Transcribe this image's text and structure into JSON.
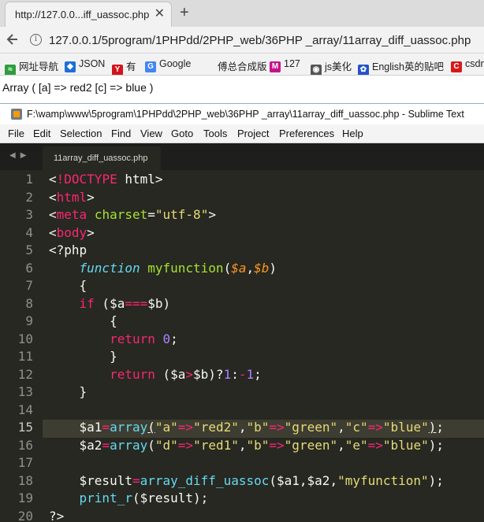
{
  "browser": {
    "tab_title": "http://127.0.0...iff_uassoc.php",
    "close_glyph": "✕",
    "new_tab_glyph": "+",
    "url": "127.0.0.1/5program/1PHPdd/2PHP_web/36PHP _array/11array_diff_uassoc.php",
    "bookmarks": [
      {
        "label": "网址导航",
        "icon": "wave-icon",
        "color": "#2e9e3e"
      },
      {
        "label": "JSON",
        "icon": "json-icon",
        "color": "#1e6fd9"
      },
      {
        "label": "有",
        "icon": "y-icon",
        "color": "#d4141d"
      },
      {
        "label": "Google",
        "icon": "google-icon",
        "color": "#4285f4"
      },
      {
        "label": "傅总合成版",
        "icon": "",
        "color": ""
      },
      {
        "label": "127",
        "icon": "m-icon",
        "color": "#c4138c"
      },
      {
        "label": "js美化",
        "icon": "globe-icon",
        "color": "#555555"
      },
      {
        "label": "English英的贴吧",
        "icon": "paw-icon",
        "color": "#2453c7"
      },
      {
        "label": "csdn",
        "icon": "c-icon",
        "color": "#d61a1a"
      }
    ]
  },
  "page_output": "Array ( [a] => red2 [c] => blue )",
  "sublime": {
    "title": "F:\\wamp\\www\\5program\\1PHPdd\\2PHP_web\\36PHP _array\\11array_diff_uassoc.php - Sublime Text",
    "menu": [
      "File",
      "Edit",
      "Selection",
      "Find",
      "View",
      "Goto",
      "Tools",
      "Project",
      "Preferences",
      "Help"
    ],
    "file_tab": "11array_diff_uassoc.php",
    "current_line": 15,
    "line_numbers": [
      "1",
      "2",
      "3",
      "4",
      "5",
      "6",
      "7",
      "8",
      "9",
      "10",
      "11",
      "12",
      "13",
      "14",
      "15",
      "16",
      "17",
      "18",
      "19",
      "20"
    ],
    "code": [
      [
        [
          "t-plain",
          "<"
        ],
        [
          "t-tag",
          "!DOCTYPE"
        ],
        [
          "t-plain",
          " html>"
        ]
      ],
      [
        [
          "t-plain",
          "<"
        ],
        [
          "t-tag",
          "html"
        ],
        [
          "t-plain",
          ">"
        ]
      ],
      [
        [
          "t-plain",
          "<"
        ],
        [
          "t-tag",
          "meta"
        ],
        [
          "t-plain",
          " "
        ],
        [
          "t-attr",
          "charset"
        ],
        [
          "t-plain",
          "="
        ],
        [
          "t-str",
          "\"utf-8\""
        ],
        [
          "t-plain",
          ">"
        ]
      ],
      [
        [
          "t-plain",
          "<"
        ],
        [
          "t-tag",
          "body"
        ],
        [
          "t-plain",
          ">"
        ]
      ],
      [
        [
          "t-plain",
          "<?php"
        ]
      ],
      [
        [
          "t-plain",
          "    "
        ],
        [
          "t-storage",
          "function"
        ],
        [
          "t-plain",
          " "
        ],
        [
          "t-fn",
          "myfunction"
        ],
        [
          "t-plain",
          "("
        ],
        [
          "t-param",
          "$a"
        ],
        [
          "t-plain",
          ","
        ],
        [
          "t-param",
          "$b"
        ],
        [
          "t-plain",
          ")"
        ]
      ],
      [
        [
          "t-plain",
          "    {"
        ]
      ],
      [
        [
          "t-plain",
          "    "
        ],
        [
          "t-kw",
          "if"
        ],
        [
          "t-plain",
          " ($a"
        ],
        [
          "t-op",
          "==="
        ],
        [
          "t-plain",
          "$b)"
        ]
      ],
      [
        [
          "t-plain",
          "        {"
        ]
      ],
      [
        [
          "t-plain",
          "        "
        ],
        [
          "t-kw",
          "return"
        ],
        [
          "t-plain",
          " "
        ],
        [
          "t-num",
          "0"
        ],
        [
          "t-plain",
          ";"
        ]
      ],
      [
        [
          "t-plain",
          "        }"
        ]
      ],
      [
        [
          "t-plain",
          "        "
        ],
        [
          "t-kw",
          "return"
        ],
        [
          "t-plain",
          " ($a"
        ],
        [
          "t-op",
          ">"
        ],
        [
          "t-plain",
          "$b)?"
        ],
        [
          "t-num",
          "1"
        ],
        [
          "t-plain",
          ":"
        ],
        [
          "t-op",
          "-"
        ],
        [
          "t-num",
          "1"
        ],
        [
          "t-plain",
          ";"
        ]
      ],
      [
        [
          "t-plain",
          "    }"
        ]
      ],
      [
        [
          "t-plain",
          ""
        ]
      ],
      [
        [
          "t-plain",
          "    $a1"
        ],
        [
          "t-op",
          "="
        ],
        [
          "t-support",
          "array"
        ],
        [
          "t-plain underline",
          "("
        ],
        [
          "t-str",
          "\"a\""
        ],
        [
          "t-op",
          "=>"
        ],
        [
          "t-str",
          "\"red2\""
        ],
        [
          "t-plain",
          ","
        ],
        [
          "t-str",
          "\"b\""
        ],
        [
          "t-op",
          "=>"
        ],
        [
          "t-str",
          "\"green\""
        ],
        [
          "t-plain",
          ","
        ],
        [
          "t-str",
          "\"c\""
        ],
        [
          "t-op",
          "=>"
        ],
        [
          "t-str",
          "\"blue\""
        ],
        [
          "t-plain underline",
          ")"
        ],
        [
          "t-plain",
          ";"
        ]
      ],
      [
        [
          "t-plain",
          "    $a2"
        ],
        [
          "t-op",
          "="
        ],
        [
          "t-support",
          "array"
        ],
        [
          "t-plain",
          "("
        ],
        [
          "t-str",
          "\"d\""
        ],
        [
          "t-op",
          "=>"
        ],
        [
          "t-str",
          "\"red1\""
        ],
        [
          "t-plain",
          ","
        ],
        [
          "t-str",
          "\"b\""
        ],
        [
          "t-op",
          "=>"
        ],
        [
          "t-str",
          "\"green\""
        ],
        [
          "t-plain",
          ","
        ],
        [
          "t-str",
          "\"e\""
        ],
        [
          "t-op",
          "=>"
        ],
        [
          "t-str",
          "\"blue\""
        ],
        [
          "t-plain",
          ");"
        ]
      ],
      [
        [
          "t-plain",
          ""
        ]
      ],
      [
        [
          "t-plain",
          "    $result"
        ],
        [
          "t-op",
          "="
        ],
        [
          "t-support",
          "array_diff_uassoc"
        ],
        [
          "t-plain",
          "($a1,$a2,"
        ],
        [
          "t-str",
          "\"myfunction\""
        ],
        [
          "t-plain",
          ");"
        ]
      ],
      [
        [
          "t-plain",
          "    "
        ],
        [
          "t-support",
          "print_r"
        ],
        [
          "t-plain",
          "($result);"
        ]
      ],
      [
        [
          "t-plain",
          "?>"
        ]
      ]
    ]
  }
}
